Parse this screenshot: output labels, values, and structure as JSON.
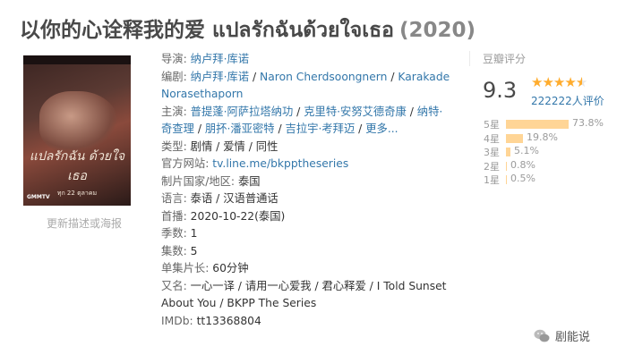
{
  "title": "以你的心诠释我的爱 แปลรักฉันด้วยใจเธอ",
  "year": "(2020)",
  "poster": {
    "caption": "แปลรักฉัน ด้วยใจเธอ",
    "date": "ทุก 22 ตุลาคม",
    "logo": "GMMTV"
  },
  "more_link": "更新描述或海报",
  "info": {
    "director_label": "导演:",
    "director": "纳卢拜·库诺",
    "writer_label": "编剧:",
    "writers": [
      "纳卢拜·库诺",
      "Naron Cherdsoongnern",
      "Karakade Norasethaporn"
    ],
    "cast_label": "主演:",
    "cast": [
      "普提蓬·阿萨拉塔纳功",
      "克里特·安努艾德奇康",
      "纳特·奇查理",
      "朋抔·潘亚密特",
      "吉拉宇·考拜迈"
    ],
    "cast_more": "更多...",
    "genre_label": "类型:",
    "genre": "剧情 / 爱情 / 同性",
    "site_label": "官方网站:",
    "site": "tv.line.me/bkpptheseries",
    "country_label": "制片国家/地区:",
    "country": "泰国",
    "language_label": "语言:",
    "language": "泰语 / 汉语普通话",
    "premiere_label": "首播:",
    "premiere": "2020-10-22(泰国)",
    "seasons_label": "季数:",
    "seasons": "1",
    "episodes_label": "集数:",
    "episodes": "5",
    "runtime_label": "单集片长:",
    "runtime": "60分钟",
    "aka_label": "又名:",
    "aka": "一心一译 / 请用一心爱我 / 君心释爱 / I Told Sunset About You / BKPP The Series",
    "imdb_label": "IMDb:",
    "imdb": "tt13368804"
  },
  "rating": {
    "label": "豆瓣评分",
    "score": "9.3",
    "stars_value": 4.5,
    "votes": "222222人评价",
    "distribution": [
      {
        "label": "5星",
        "percent": 73.8,
        "text": "73.8%"
      },
      {
        "label": "4星",
        "percent": 19.8,
        "text": "19.8%"
      },
      {
        "label": "3星",
        "percent": 5.1,
        "text": "5.1%"
      },
      {
        "label": "2星",
        "percent": 0.8,
        "text": "0.8%"
      },
      {
        "label": "1星",
        "percent": 0.5,
        "text": "0.5%"
      }
    ]
  },
  "watermark": "剧能说"
}
